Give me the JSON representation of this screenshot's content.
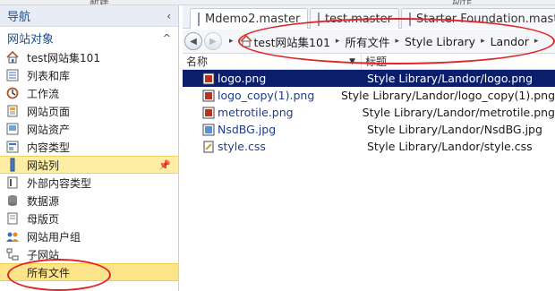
{
  "top_strip": [
    "新建",
    "动作"
  ],
  "nav": {
    "header": "导航",
    "collapse_glyph": "‹",
    "section": "网站对象",
    "section_glyph": "^",
    "pin_glyph": "📌",
    "items": [
      {
        "label": "test网站集101",
        "icon": "home-icon"
      },
      {
        "label": "列表和库",
        "icon": "list-icon"
      },
      {
        "label": "工作流",
        "icon": "workflow-icon"
      },
      {
        "label": "网站页面",
        "icon": "site-pages-icon"
      },
      {
        "label": "网站资产",
        "icon": "site-assets-icon"
      },
      {
        "label": "内容类型",
        "icon": "content-types-icon"
      },
      {
        "label": "网站列",
        "icon": "site-columns-icon"
      },
      {
        "label": "外部内容类型",
        "icon": "external-content-icon"
      },
      {
        "label": "数据源",
        "icon": "data-source-icon"
      },
      {
        "label": "母版页",
        "icon": "master-pages-icon"
      },
      {
        "label": "网站用户组",
        "icon": "site-groups-icon"
      },
      {
        "label": "子网站",
        "icon": "subsites-icon"
      },
      {
        "label": "所有文件",
        "icon": "all-files-icon"
      }
    ]
  },
  "tabs": [
    {
      "label": "Mdemo2.master"
    },
    {
      "label": "test.master"
    },
    {
      "label": "Starter Foundation.master"
    }
  ],
  "breadcrumb": {
    "back_glyph": "◀",
    "forward_glyph": "▶",
    "separator": "▸",
    "items": [
      "test网站集101",
      "所有文件",
      "Style Library",
      "Landor"
    ]
  },
  "columns": {
    "name": "名称",
    "title": "标题"
  },
  "files": [
    {
      "name": "logo.png",
      "title": "Style Library/Landor/logo.png",
      "icon": "image-file-icon"
    },
    {
      "name": "logo_copy(1).png",
      "title": "Style Library/Landor/logo_copy(1).png",
      "icon": "image-file-icon"
    },
    {
      "name": "metrotile.png",
      "title": "Style Library/Landor/metrotile.png",
      "icon": "image-file-icon"
    },
    {
      "name": "NsdBG.jpg",
      "title": "Style Library/Landor/NsdBG.jpg",
      "icon": "image-file-icon"
    },
    {
      "name": "style.css",
      "title": "Style Library/Landor/style.css",
      "icon": "css-file-icon"
    }
  ],
  "colors": {
    "accent": "#1e4e8c",
    "selection": "#0b1e6b",
    "highlight": "#fce48a",
    "annotation": "#e0252a"
  }
}
